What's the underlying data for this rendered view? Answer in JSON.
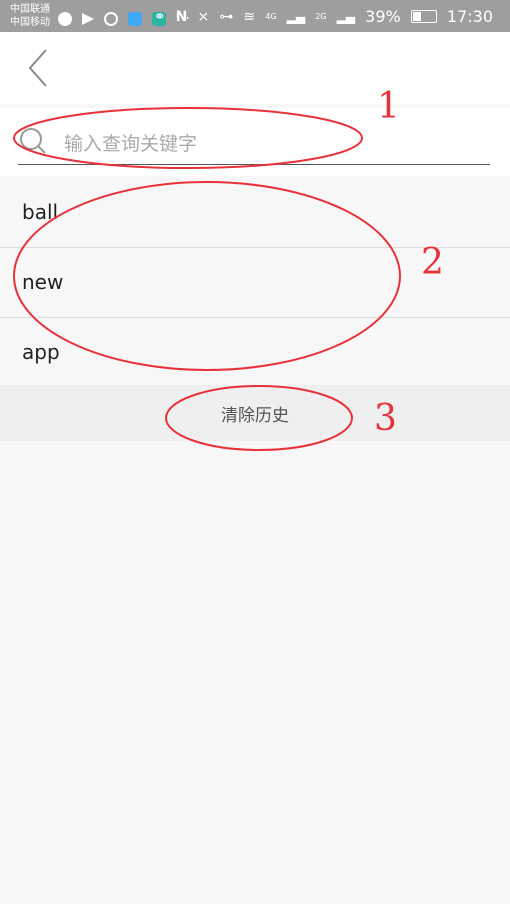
{
  "status_bar": {
    "carrier_1": "中国联通",
    "carrier_2": "中国移动",
    "network_1": "4G",
    "network_2": "2G",
    "battery": "39%",
    "time": "17:30",
    "overflow": "···"
  },
  "search": {
    "placeholder": "输入查询关键字"
  },
  "history": {
    "items": [
      {
        "label": "ball"
      },
      {
        "label": "new"
      },
      {
        "label": "app"
      }
    ],
    "clear_label": "清除历史"
  },
  "annotations": {
    "labels": [
      "1",
      "2",
      "3"
    ],
    "color": "#e8323a"
  },
  "colors": {
    "status_bar_bg": "#9e9e9e",
    "page_bg": "#f7f7f7",
    "annotation_red": "#e8323a"
  }
}
